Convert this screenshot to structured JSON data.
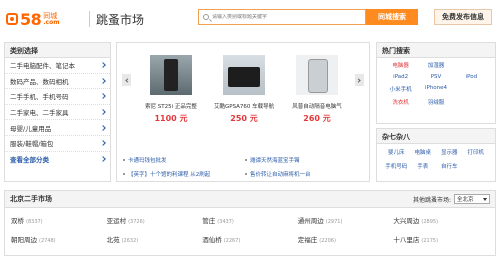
{
  "header": {
    "logo_num": "58",
    "logo_city": "同城",
    "logo_com": ".com",
    "page_title": "跳蚤市场",
    "search_placeholder": "请输入类别或标题关键字",
    "search_button": "同城搜索",
    "free_post_button": "免费发布信息"
  },
  "categories": {
    "title": "类别选择",
    "items": [
      "二手电脑配件、笔记本",
      "数码产品、数码相机",
      "二手手机、手机号码",
      "二手家电、二手家具",
      "母婴/儿童用品",
      "服装/鞋帽/箱包"
    ],
    "view_all": "查看全部分类"
  },
  "promo": {
    "products": [
      {
        "name": "索尼 ST25i 正品完整",
        "price": "1100 元"
      },
      {
        "name": "艾酷GPSA760 车载导航",
        "price": "250 元"
      },
      {
        "name": "风普自动隔音电脑气",
        "price": "260 元"
      }
    ],
    "news": [
      [
        "卡通玛钱包批发",
        "潍谭天然海蓝宝手镯"
      ],
      [
        "【英字】十个馆的利课程 从2刷起",
        "售价转让自动麻将机一台"
      ]
    ]
  },
  "hot_search": {
    "title": "热门搜索",
    "tags": [
      {
        "label": "电脑器",
        "color": "red"
      },
      {
        "label": "加湿器",
        "color": "blue"
      },
      {
        "label": "",
        "color": "blue"
      },
      {
        "label": "iPad2",
        "color": "blue"
      },
      {
        "label": "PSV",
        "color": "blue"
      },
      {
        "label": "iPod",
        "color": "blue"
      },
      {
        "label": "小米手机",
        "color": "blue"
      },
      {
        "label": "iPhone4",
        "color": "blue"
      },
      {
        "label": "",
        "color": "blue"
      },
      {
        "label": "洗衣机",
        "color": "red"
      },
      {
        "label": "羽绒服",
        "color": "blue"
      },
      {
        "label": "",
        "color": "blue"
      }
    ]
  },
  "qi": {
    "title": "杂七杂八",
    "tags": [
      "婴儿床",
      "电脑桌",
      "显示器",
      "打印机",
      "手机号码",
      "手表",
      "自行车",
      ""
    ]
  },
  "market": {
    "title": "北京二手市场",
    "other_label": "其他跳蚤市场:",
    "city_value": "全北京",
    "areas": [
      {
        "name": "双桥",
        "count": "(8337)"
      },
      {
        "name": "亚运村",
        "count": "(3726)"
      },
      {
        "name": "管庄",
        "count": "(3437)"
      },
      {
        "name": "通州周边",
        "count": "(2971)"
      },
      {
        "name": "大兴周边",
        "count": "(2895)"
      },
      {
        "name": "朝阳周边",
        "count": "(2748)"
      },
      {
        "name": "北苑",
        "count": "(2632)"
      },
      {
        "name": "酒仙桥",
        "count": "(2267)"
      },
      {
        "name": "定福庄",
        "count": "(2206)"
      },
      {
        "name": "十八里店",
        "count": "(2175)"
      }
    ]
  },
  "colors": {
    "brand": "#ff6600",
    "price": "#e4393c",
    "link": "#2a5caa",
    "search_button": "#ff8a1f"
  }
}
